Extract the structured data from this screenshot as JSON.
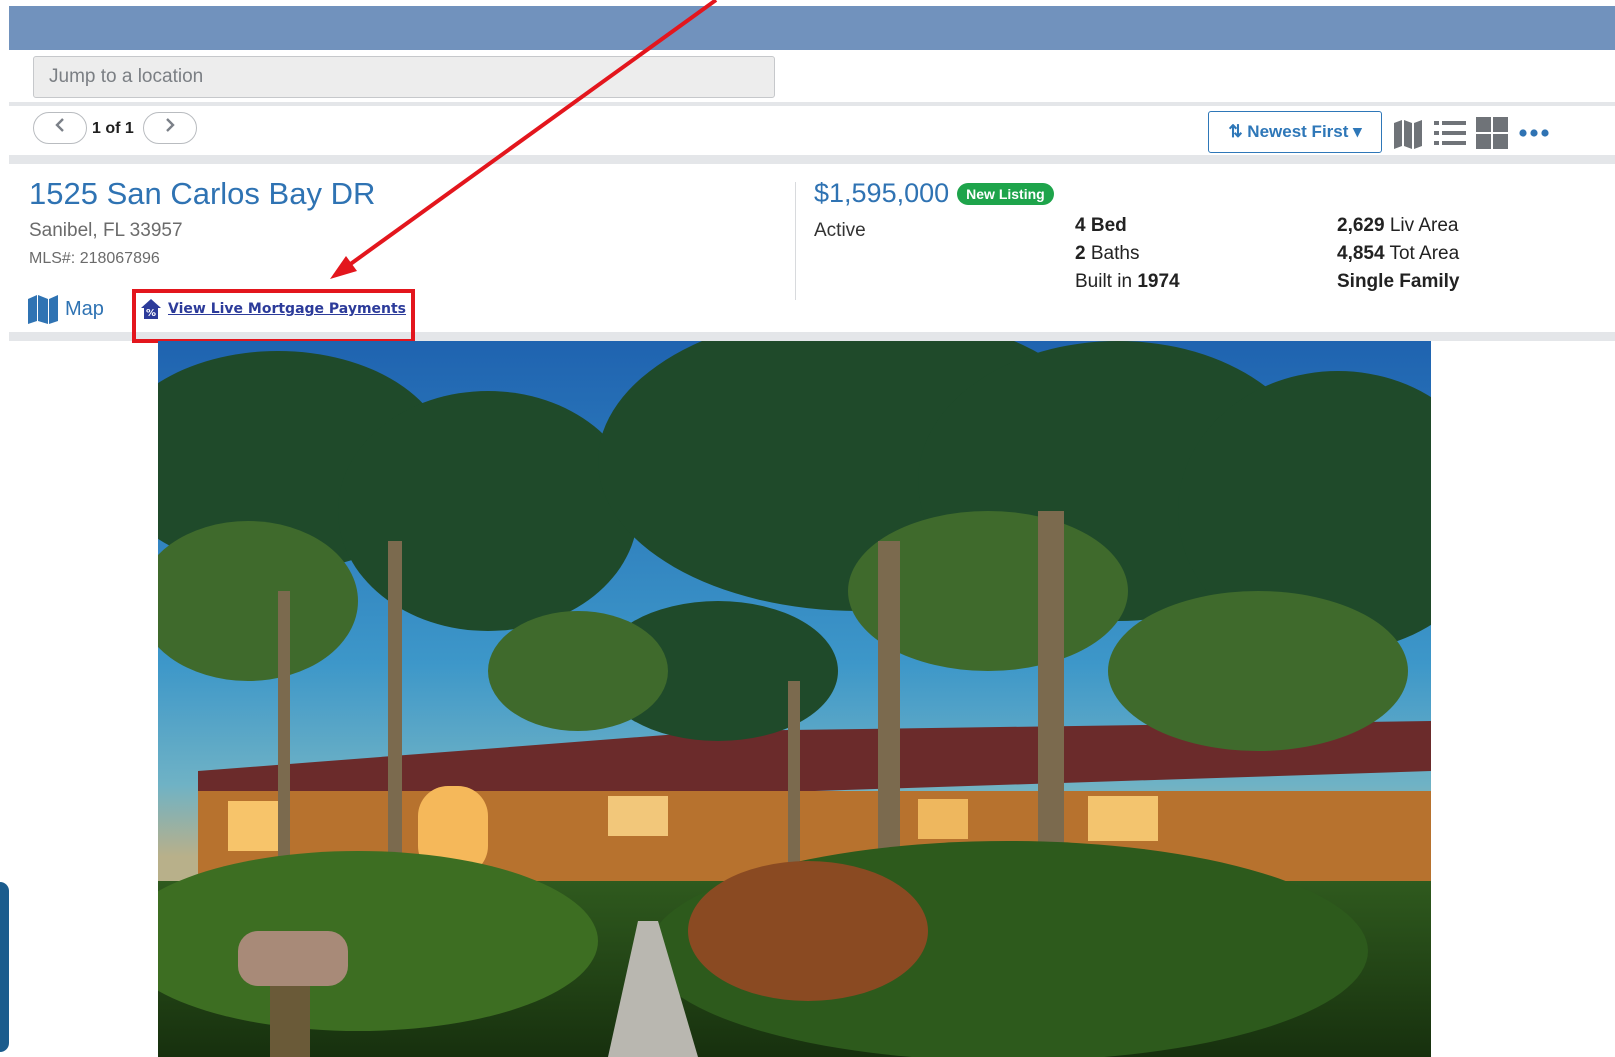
{
  "search": {
    "placeholder": "Jump to a location"
  },
  "pager": {
    "prev_icon": "chevron-left",
    "text": "1 of 1",
    "next_icon": "chevron-right"
  },
  "sort": {
    "label": "⇅ Newest First ▾"
  },
  "view_icons": [
    "map-view-icon",
    "list-view-icon",
    "grid-view-icon",
    "more-icon"
  ],
  "listing": {
    "address": "1525 San Carlos Bay DR",
    "city_state_zip": "Sanibel, FL 33957",
    "mls": "MLS#: 218067896",
    "map_label": "Map",
    "mortgage_label": " View Live Mortgage Payments",
    "price": "$1,595,000",
    "badge": "New Listing",
    "status": "Active",
    "beds_value": "4 Bed",
    "baths_value": "2",
    "baths_label": " Baths",
    "built_label": "Built in ",
    "built_value": "1974",
    "liv_value": "2,629",
    "liv_label": " Liv Area",
    "tot_value": "4,854",
    "tot_label": " Tot Area",
    "type": "Single Family"
  },
  "colors": {
    "topbar": "#7192bd",
    "accent": "#2f73b3",
    "badge": "#1ea44b",
    "annotation": "#e3161d"
  }
}
